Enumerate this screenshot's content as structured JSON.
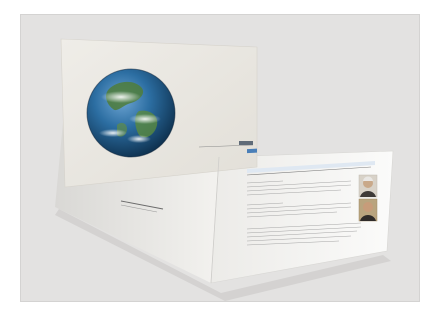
{
  "photo": {
    "subject": "brochure-with-earth-cover",
    "colors": {
      "background": "#e3e2e1",
      "paper": "#f6f5f2",
      "paper_shadow": "#d7d6d3",
      "cover": "#ece9e2",
      "earth_ocean": "#1f5b8c",
      "earth_land": "#4f7d3a",
      "accent_bar": "#4a7fb8"
    }
  }
}
